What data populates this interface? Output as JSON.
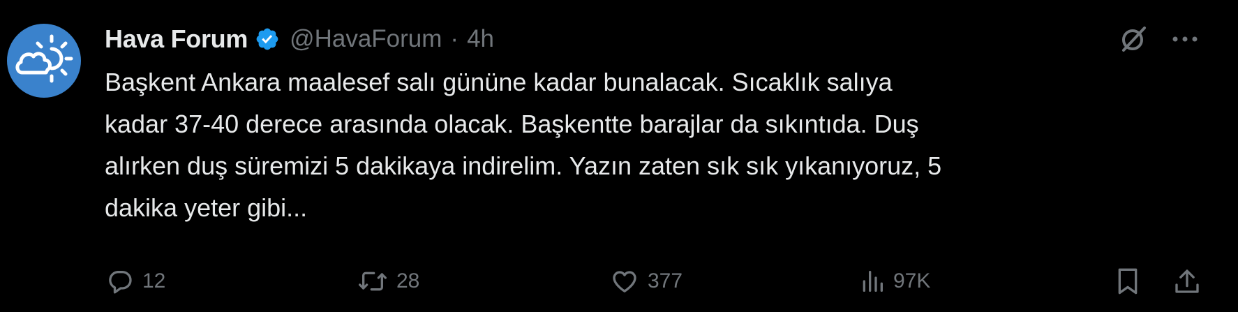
{
  "author": {
    "display_name": "Hava Forum",
    "handle": "@HavaForum",
    "separator": "·",
    "time": "4h",
    "avatar_icon": "weather-sun-cloud-icon",
    "verified_icon": "verified-badge-icon"
  },
  "tweet": {
    "text": "Başkent Ankara maalesef salı gününe kadar bunalacak. Sıcaklık salıya\nkadar 37-40 derece arasında olacak. Başkentte barajlar da sıkıntıda. Duş\nalırken duş süremizi 5 dakikaya indirelim. Yazın zaten sık sık yıkanıyoruz, 5\ndakika yeter gibi..."
  },
  "header_actions": {
    "grok_icon": "grok-icon",
    "more_icon": "more-dots-icon"
  },
  "actions": {
    "reply": {
      "icon": "reply-icon",
      "count": "12"
    },
    "repost": {
      "icon": "repost-icon",
      "count": "28"
    },
    "like": {
      "icon": "heart-icon",
      "count": "377"
    },
    "views": {
      "icon": "views-chart-icon",
      "count": "97K"
    },
    "bookmark": {
      "icon": "bookmark-icon"
    },
    "share": {
      "icon": "share-icon"
    }
  },
  "colors": {
    "background": "#000000",
    "text_primary": "#e7e9ea",
    "text_secondary": "#71767b",
    "verified_blue": "#1d9bf0",
    "avatar_blue": "#3a82cc"
  }
}
